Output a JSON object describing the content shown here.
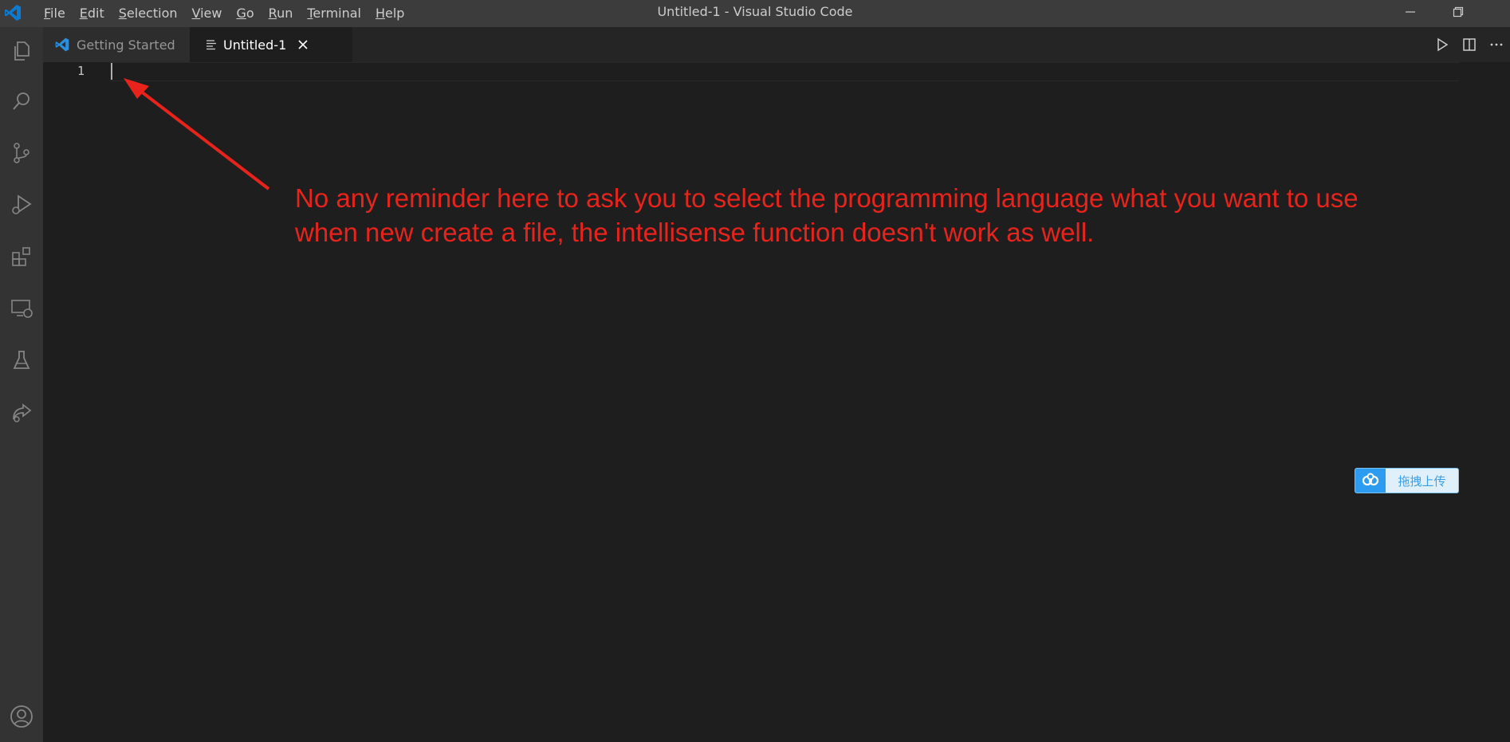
{
  "window": {
    "title": "Untitled-1 - Visual Studio Code"
  },
  "menu": [
    {
      "key": "F",
      "rest": "ile"
    },
    {
      "key": "E",
      "rest": "dit"
    },
    {
      "key": "S",
      "rest": "election"
    },
    {
      "key": "V",
      "rest": "iew"
    },
    {
      "key": "G",
      "rest": "o"
    },
    {
      "key": "R",
      "rest": "un"
    },
    {
      "key": "T",
      "rest": "erminal"
    },
    {
      "key": "H",
      "rest": "elp"
    }
  ],
  "tabs": [
    {
      "label": "Getting Started",
      "active": false
    },
    {
      "label": "Untitled-1",
      "active": true
    }
  ],
  "editor": {
    "line_numbers": [
      "1"
    ],
    "content": ""
  },
  "annotation": {
    "line1": "No any reminder here to ask you to select the programming language what you want to use",
    "line2": "when new create a file, the intellisense function doesn't work as well.",
    "color": "#e8231c"
  },
  "upload_widget": {
    "label": "拖拽上传"
  },
  "colors": {
    "titlebar": "#3c3c3c",
    "activitybar": "#333333",
    "editor_bg": "#1e1e1e",
    "vscode_blue": "#0b7ad1"
  }
}
